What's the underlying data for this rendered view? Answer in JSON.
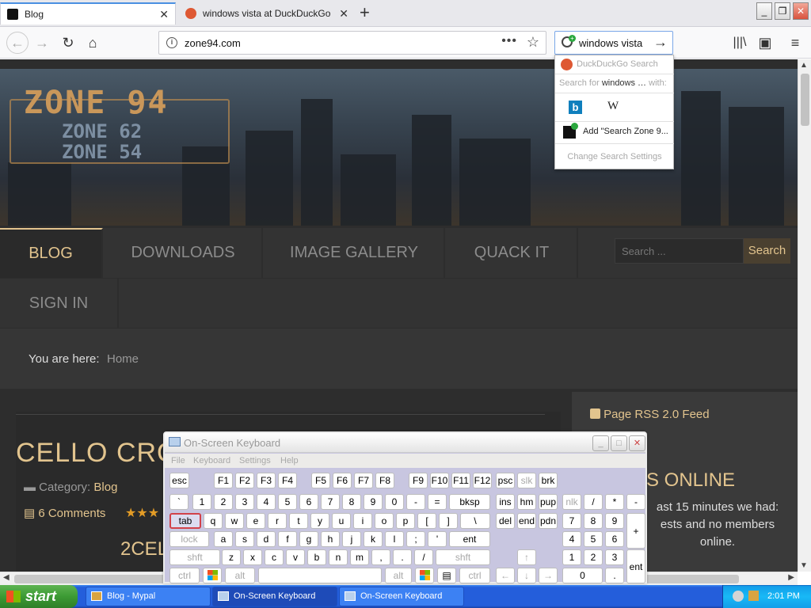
{
  "browser": {
    "tabs": [
      {
        "title": "Blog",
        "active": true
      },
      {
        "title": "windows vista at DuckDuckGo",
        "active": false
      }
    ],
    "new_tab": "+",
    "window_controls": {
      "minimize": "_",
      "maximize": "❐",
      "close": "✕"
    },
    "url": "zone94.com",
    "search_value": "windows vista",
    "nav_icons": [
      "back-arrow-icon",
      "forward-arrow-icon",
      "reload-icon",
      "home-icon"
    ],
    "toolbar_icons": [
      "library-icon",
      "sidebar-icon",
      "menu-icon"
    ]
  },
  "search_dropdown": {
    "engine_header": "DuckDuckGo Search",
    "search_for_prefix": "Search for",
    "search_for_term": "windows …",
    "search_for_suffix": "with:",
    "engines": [
      "b",
      "W"
    ],
    "add_engine": "Add \"Search Zone 9...",
    "change_settings": "Change Search Settings"
  },
  "site": {
    "logo_main": "ZONE 94",
    "logo_sub1": "ZONE 62",
    "logo_sub2": "ZONE 54",
    "menu": [
      "BLOG",
      "DOWNLOADS",
      "IMAGE GALLERY",
      "QUACK IT",
      "SIGN IN"
    ],
    "active_menu": "BLOG",
    "search_placeholder": "Search ...",
    "search_button": "Search",
    "breadcrumb_label": "You are here:",
    "breadcrumb_home": "Home",
    "post_title": "CELLO CROSSO",
    "post_category_label": "Category:",
    "post_category": "Blog",
    "post_comments": "6 Comments",
    "post_stars": "★★★",
    "post_subtitle": "2CELL",
    "rss_label": "Page RSS 2.0 Feed",
    "online_title": "S ONLINE",
    "online_text": "ast 15 minutes we had: ests and no members online."
  },
  "osk": {
    "title": "On-Screen Keyboard",
    "menu": [
      "File",
      "Keyboard",
      "Settings",
      "Help"
    ],
    "selected_key": "tab"
  },
  "taskbar": {
    "start": "start",
    "items": [
      "Blog - Mypal",
      "On-Screen Keyboard",
      "On-Screen Keyboard"
    ],
    "time": "2:01 PM"
  },
  "colors": {
    "accent_gold": "#e2c48e",
    "page_bg": "#2d2d2d",
    "xp_blue": "#245edb",
    "xp_start_green": "#3c9a34"
  }
}
